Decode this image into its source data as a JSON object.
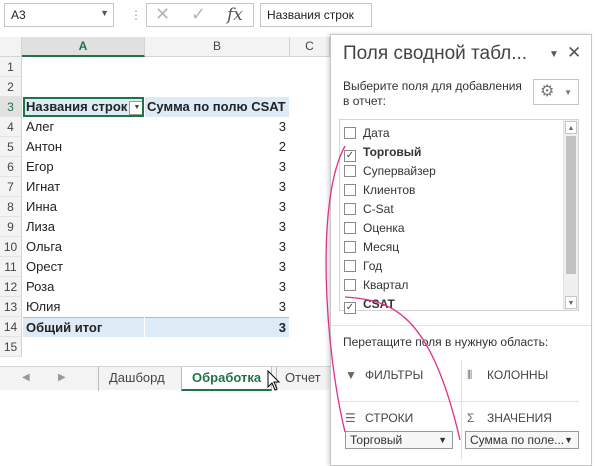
{
  "formula_bar": {
    "name_box": "A3",
    "fx": "fx",
    "content": "Названия строк"
  },
  "columns": [
    "A",
    "B",
    "C"
  ],
  "rows": [
    {
      "num": "1",
      "a": "",
      "b": ""
    },
    {
      "num": "2",
      "a": "",
      "b": ""
    },
    {
      "num": "3",
      "a": "Названия строк",
      "b": "Сумма по полю CSAT"
    },
    {
      "num": "4",
      "a": "Алег",
      "b": "3"
    },
    {
      "num": "5",
      "a": "Антон",
      "b": "2"
    },
    {
      "num": "6",
      "a": "Егор",
      "b": "3"
    },
    {
      "num": "7",
      "a": "Игнат",
      "b": "3"
    },
    {
      "num": "8",
      "a": "Инна",
      "b": "3"
    },
    {
      "num": "9",
      "a": "Лиза",
      "b": "3"
    },
    {
      "num": "10",
      "a": "Ольга",
      "b": "3"
    },
    {
      "num": "11",
      "a": "Орест",
      "b": "3"
    },
    {
      "num": "12",
      "a": "Роза",
      "b": "3"
    },
    {
      "num": "13",
      "a": "Юлия",
      "b": "3"
    },
    {
      "num": "14",
      "a": "Общий итог",
      "b": "3"
    },
    {
      "num": "15",
      "a": "",
      "b": ""
    }
  ],
  "sheet_tabs": [
    "Дашборд",
    "Обработка",
    "Отчет"
  ],
  "active_tab": "Обработка",
  "pivot_panel": {
    "title": "Поля сводной табл...",
    "subtitle": "Выберите поля для добавления в отчет:",
    "fields": [
      {
        "label": "Дата",
        "checked": false
      },
      {
        "label": "Торговый",
        "checked": true
      },
      {
        "label": "Супервайзер",
        "checked": false
      },
      {
        "label": "Клиентов",
        "checked": false
      },
      {
        "label": "C-Sat",
        "checked": false
      },
      {
        "label": "Оценка",
        "checked": false
      },
      {
        "label": "Месяц",
        "checked": false
      },
      {
        "label": "Год",
        "checked": false
      },
      {
        "label": "Квартал",
        "checked": false
      },
      {
        "label": "CSAT",
        "checked": true
      }
    ],
    "drag_hint": "Перетащите поля в нужную область:",
    "areas": {
      "filters": "ФИЛЬТРЫ",
      "columns": "КОЛОННЫ",
      "rows": "СТРОКИ",
      "values": "ЗНАЧЕНИЯ"
    },
    "rows_pill": "Торговый",
    "values_pill": "Сумма по поле...",
    "check_mark": "✓"
  },
  "accent_color": "#217346",
  "annotation_color": "#e0308a"
}
